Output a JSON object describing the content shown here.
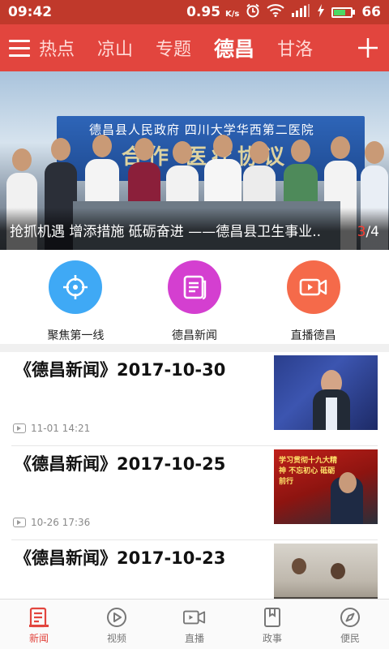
{
  "status_bar": {
    "time": "09:42",
    "net_speed": "0.95",
    "net_speed_unit": "K/s",
    "battery_percent": "66",
    "battery_level": 0.66
  },
  "nav": {
    "tabs": [
      {
        "label": "热点",
        "active": false
      },
      {
        "label": "凉山",
        "active": false
      },
      {
        "label": "专题",
        "active": false
      },
      {
        "label": "德昌",
        "active": true
      },
      {
        "label": "甘洛",
        "active": false
      }
    ],
    "menu_icon": "hamburger-icon",
    "add_icon": "plus-icon"
  },
  "banner": {
    "backdrop_text": "德昌县人民政府  四川大学华西第二医院",
    "backdrop_text2": "合作  医疗协议",
    "caption": "抢抓机遇 增添措施 砥砺奋进 ——德昌县卫生事业..",
    "pager_current": "3",
    "pager_total": "/4"
  },
  "quick_entries": [
    {
      "label": "聚焦第一线",
      "icon": "crosshair-icon",
      "color": "#3fa9f5"
    },
    {
      "label": "德昌新闻",
      "icon": "document-icon",
      "color": "#d43fd0"
    },
    {
      "label": "直播德昌",
      "icon": "video-camera-icon",
      "color": "#f56a4a"
    }
  ],
  "news": [
    {
      "title": "《德昌新闻》2017-10-30",
      "time": "11-01 14:21"
    },
    {
      "title": "《德昌新闻》2017-10-25",
      "time": "10-26 17:36"
    },
    {
      "title": "《德昌新闻》2017-10-23",
      "time": ""
    }
  ],
  "thumb_text": {
    "t2": "学习贯彻十九大精神 不忘初心 砥砺前行"
  },
  "bottom_nav": [
    {
      "label": "新闻",
      "icon": "news-icon",
      "active": true
    },
    {
      "label": "视频",
      "icon": "play-circle-icon",
      "active": false
    },
    {
      "label": "直播",
      "icon": "video-camera-icon",
      "active": false
    },
    {
      "label": "政事",
      "icon": "book-icon",
      "active": false
    },
    {
      "label": "便民",
      "icon": "compass-icon",
      "active": false
    }
  ],
  "colors": {
    "primary": "#e2453e",
    "status_bar": "#c0392b",
    "battery_fill": "#4cd964"
  }
}
